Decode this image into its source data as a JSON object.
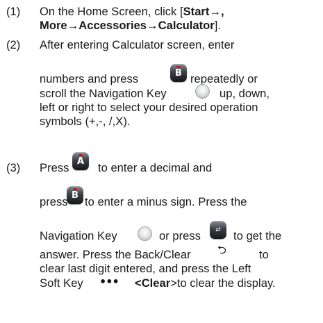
{
  "steps": [
    {
      "number": "(1)",
      "line1_text": "On the Home Screen, click [",
      "line1_bold": "Start→,",
      "line2_bold": "More→Accessories→Calculator",
      "line2_text": "]."
    },
    {
      "number": "(2)",
      "line1": "After entering Calculator screen, enter",
      "line2_before": "numbers and press",
      "line2_after": "repeatedly or",
      "line3_before": "scroll the Navigation Key",
      "line3_after": "up, down,",
      "line4": "left or right to select your desired operation",
      "line5": "symbols (+,-, /,X)."
    },
    {
      "number": "(3)",
      "line1_before": "Press",
      "line1_after": "to enter a decimal and",
      "line2_before": "press",
      "line2_after": "to enter a minus sign. Press the",
      "line3_before": "Navigation Key",
      "line3_middle": "or press",
      "line3_after": "to get the",
      "line4_before": "answer. Press the Back/Clear",
      "line4_after": "to",
      "line5": "clear last digit entered, and press the Left",
      "line6_before": "Soft Key",
      "line6_bold": "<Clear",
      "line6_after": ">to clear the display."
    }
  ],
  "icons": {
    "key_b_letter": "B",
    "key_a_letter": "A",
    "send_key_symbol": "⇄",
    "back_symbol": "⮌",
    "soft_key_symbol": "•••"
  }
}
